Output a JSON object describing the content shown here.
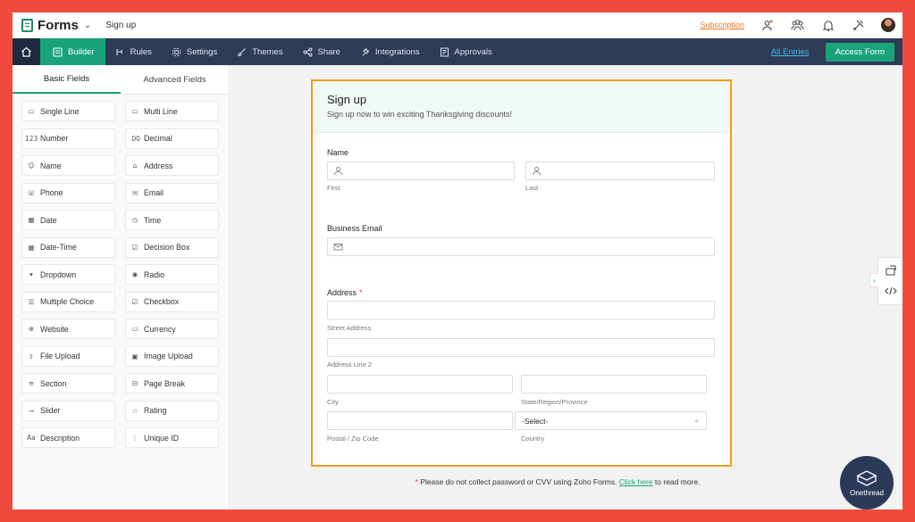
{
  "app": {
    "name": "Forms",
    "form_name": "Sign up"
  },
  "topbar": {
    "subscription": "Subscription"
  },
  "nav": {
    "items": [
      {
        "label": "Builder",
        "icon": "builder-icon",
        "active": true
      },
      {
        "label": "Rules",
        "icon": "rules-icon"
      },
      {
        "label": "Settings",
        "icon": "gear-icon"
      },
      {
        "label": "Themes",
        "icon": "brush-icon"
      },
      {
        "label": "Share",
        "icon": "share-icon"
      },
      {
        "label": "Integrations",
        "icon": "plug-icon"
      },
      {
        "label": "Approvals",
        "icon": "approvals-icon"
      }
    ],
    "all_entries": "All Entries",
    "access_form": "Access Form"
  },
  "left_panel": {
    "tabs": [
      "Basic Fields",
      "Advanced Fields"
    ],
    "fields": [
      {
        "label": "Single Line",
        "glyph": "▭"
      },
      {
        "label": "Multi Line",
        "glyph": "▭"
      },
      {
        "label": "Number",
        "glyph": "123"
      },
      {
        "label": "Decimal",
        "glyph": ".00"
      },
      {
        "label": "Name",
        "glyph": "☺"
      },
      {
        "label": "Address",
        "glyph": "⌂"
      },
      {
        "label": "Phone",
        "glyph": "☏"
      },
      {
        "label": "Email",
        "glyph": "✉"
      },
      {
        "label": "Date",
        "glyph": "▦"
      },
      {
        "label": "Time",
        "glyph": "◷"
      },
      {
        "label": "Date-Time",
        "glyph": "▦"
      },
      {
        "label": "Decision Box",
        "glyph": "☑"
      },
      {
        "label": "Dropdown",
        "glyph": "▾"
      },
      {
        "label": "Radio",
        "glyph": "◉"
      },
      {
        "label": "Multiple Choice",
        "glyph": "☰"
      },
      {
        "label": "Checkbox",
        "glyph": "☑"
      },
      {
        "label": "Website",
        "glyph": "⊕"
      },
      {
        "label": "Currency",
        "glyph": "▭"
      },
      {
        "label": "File Upload",
        "glyph": "⇧"
      },
      {
        "label": "Image Upload",
        "glyph": "▣"
      },
      {
        "label": "Section",
        "glyph": "≡"
      },
      {
        "label": "Page Break",
        "glyph": "⊟"
      },
      {
        "label": "Slider",
        "glyph": "⊸"
      },
      {
        "label": "Rating",
        "glyph": "☆"
      },
      {
        "label": "Description",
        "glyph": "Aa"
      },
      {
        "label": "Unique ID",
        "glyph": "⋮"
      }
    ]
  },
  "form": {
    "title": "Sign up",
    "description": "Sign up now to win exciting Thanksgiving discounts!",
    "name_label": "Name",
    "first_sub": "First",
    "last_sub": "Last",
    "email_label": "Business Email",
    "address_label": "Address",
    "address_required": "*",
    "street_sub": "Street Address",
    "line2_sub": "Address Line 2",
    "city_sub": "City",
    "state_sub": "State/Region/Province",
    "zip_sub": "Postal / Zip Code",
    "country_sub": "Country",
    "country_value": "-Select-"
  },
  "note": {
    "star": "*",
    "text": "Please do not collect password or CVV using Zoho Forms.",
    "link": "Click here",
    "tail": "to read more."
  },
  "brand": {
    "text": "Onethread"
  },
  "colors": {
    "accent": "#1aa37a",
    "nav": "#2d3c57",
    "highlight": "#f39a1a",
    "frame": "#f04a3f"
  }
}
